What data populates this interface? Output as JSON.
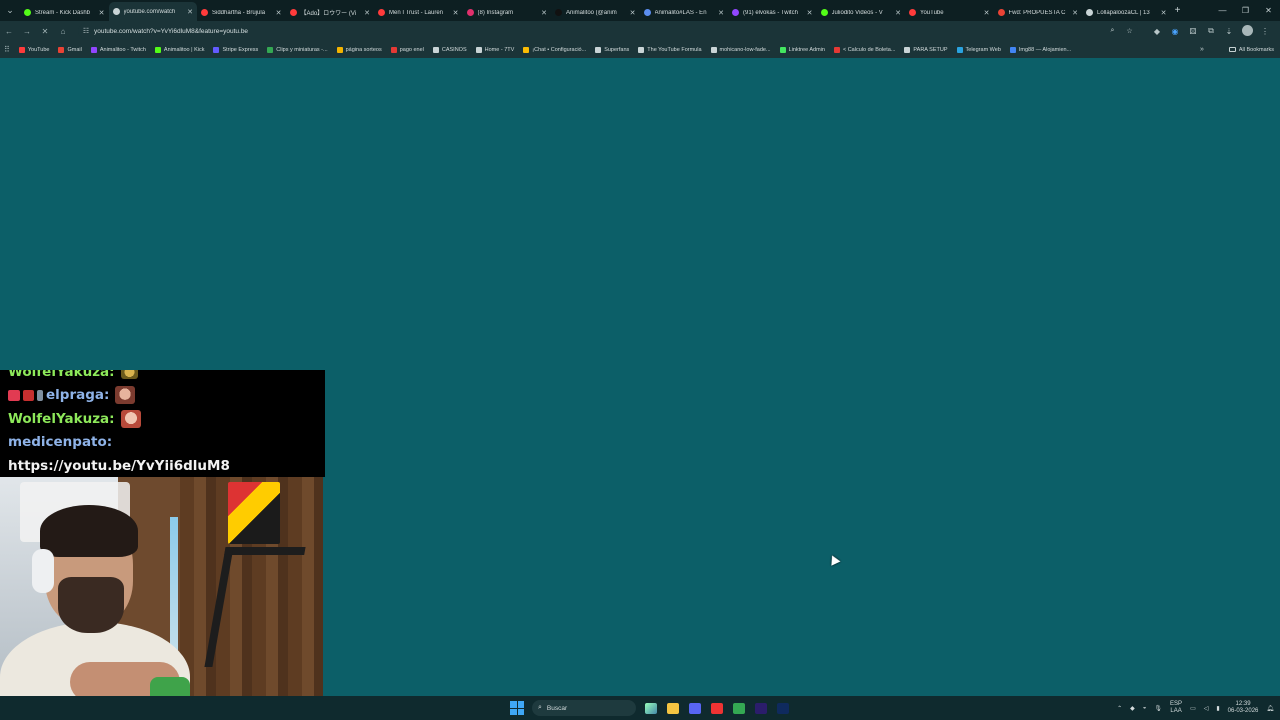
{
  "browser": {
    "tabs": [
      {
        "title": "Stream - Kick Dashb",
        "color": "#53fc18",
        "active": false
      },
      {
        "title": "youtube.com/watch",
        "color": "#c9d4d6",
        "active": true
      },
      {
        "title": "Siddhartha - Brújula",
        "color": "#ff3b3b",
        "active": false
      },
      {
        "title": "【Ado】ロウワー (Vi",
        "color": "#ff3b3b",
        "active": false
      },
      {
        "title": "Men I Trust - Lauren",
        "color": "#ff3b3b",
        "active": false
      },
      {
        "title": "(8) Instagram",
        "color": "#e1306c",
        "active": false
      },
      {
        "title": "Animalitoo (@anim",
        "color": "#111111",
        "active": false
      },
      {
        "title": "Animalito#LAS - En",
        "color": "#5b8def",
        "active": false
      },
      {
        "title": "(91) elvokas - Twitch",
        "color": "#9146ff",
        "active": false
      },
      {
        "title": "Juliodito Videos - V",
        "color": "#53fc18",
        "active": false
      },
      {
        "title": "YouTube",
        "color": "#ff3b3b",
        "active": false
      },
      {
        "title": "Fwd: PROPUESTA C",
        "color": "#ea4335",
        "active": false
      },
      {
        "title": "LollapaloozaCL | 13",
        "color": "#c9d4d6",
        "active": false
      }
    ],
    "url": "youtube.com/watch?v=YvYi6dluM8&feature=youtu.be",
    "bookmarks": [
      {
        "label": "YouTube",
        "color": "#ff3b3b"
      },
      {
        "label": "Gmail",
        "color": "#ea4335"
      },
      {
        "label": "Animalitoo - Twitch",
        "color": "#9146ff"
      },
      {
        "label": "Animalitoo | Kick",
        "color": "#53fc18"
      },
      {
        "label": "Stripe Express",
        "color": "#635bff"
      },
      {
        "label": "Clips y miniaturas -...",
        "color": "#34a853"
      },
      {
        "label": "página sorteos",
        "color": "#f4b400"
      },
      {
        "label": "pago enel",
        "color": "#e53935"
      },
      {
        "label": "CASINOS",
        "color": "#c9d4d6"
      },
      {
        "label": "Home - 7TV",
        "color": "#c9d4d6"
      },
      {
        "label": "¡Chat • Configuració...",
        "color": "#fbbc04"
      },
      {
        "label": "Superfans",
        "color": "#c9d4d6"
      },
      {
        "label": "The YouTube Formula",
        "color": "#c9d4d6"
      },
      {
        "label": "mohicano-low-fade...",
        "color": "#c9d4d6"
      },
      {
        "label": "Linktree Admin",
        "color": "#43e660"
      },
      {
        "label": "< Calculo de Boleta...",
        "color": "#e53935"
      },
      {
        "label": "PARA SETUP",
        "color": "#c9d4d6"
      },
      {
        "label": "Telegram Web",
        "color": "#2aa3e0"
      },
      {
        "label": "Img88 — Alojamien...",
        "color": "#4285f4"
      }
    ],
    "all_bookmarks_label": "All Bookmarks"
  },
  "chat": {
    "messages": [
      {
        "user": "WolfelYakuza:",
        "color": "#8de85a",
        "text": ""
      },
      {
        "user": "elpraga:",
        "color": "#8fb3e8",
        "text": ""
      },
      {
        "user": "WolfelYakuza:",
        "color": "#8de85a",
        "text": ""
      },
      {
        "user": "medicenpato:",
        "color": "#8fb3e8",
        "text": ""
      },
      {
        "user": "",
        "color": "#f2f2f2",
        "text": "https://youtu.be/YvYii6dluM8"
      }
    ]
  },
  "taskbar": {
    "search_placeholder": "Buscar",
    "language": "ESP",
    "layout": "LAA",
    "time": "12:39",
    "date": "06-03-2026",
    "apps": [
      {
        "name": "file-explorer",
        "color": "#f4c542"
      },
      {
        "name": "discord",
        "color": "#5865f2"
      },
      {
        "name": "obs",
        "color": "#e33"
      },
      {
        "name": "chrome",
        "color": "#34a853"
      },
      {
        "name": "premiere",
        "color": "#2b1d6b"
      },
      {
        "name": "photoshop",
        "color": "#0f2a5e"
      }
    ]
  }
}
